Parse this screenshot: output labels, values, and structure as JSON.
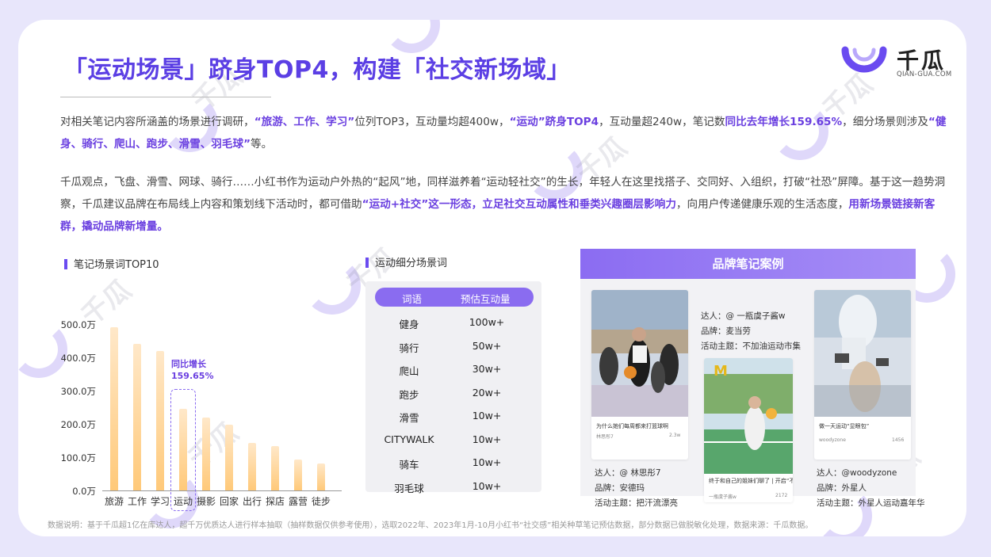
{
  "title": "「运动场景」跻身TOP4，构建「社交新场域」",
  "logo": {
    "cn": "千瓜",
    "en": "QIAN-GUA.COM"
  },
  "para1": {
    "t1": "对相关笔记内容所涵盖的场景进行调研，",
    "h1": "“旅游、工作、学习”",
    "t2": "位列TOP3，互动量均超400w，",
    "h2": "“运动”跻身TOP4",
    "t3": "，互动量超240w，笔记数",
    "h3": "同比去年增长159.65%",
    "t4": "，细分场景则涉及",
    "h4": "“健身、骑行、爬山、跑步、滑雪、羽毛球”",
    "t5": "等。"
  },
  "para2": {
    "t1": "千瓜观点，飞盘、滑雪、网球、骑行……小红书作为运动户外热的“起风”地，同样滋养着“运动轻社交”的生长，年轻人在这里找搭子、交同好、入组织，打破“社恐”屏障。基于这一趋势洞察，千瓜建议品牌在布局线上内容和策划线下活动时，都可借助",
    "h1": "“运动+社交”这一形态，立足社交互动属性和垂类兴趣圈层影响力",
    "t2": "，向用户传递健康乐观的生活态度，",
    "h2": "用新场景链接新客群，撬动品牌新增量。"
  },
  "chart_section_title": "笔记场景词TOP10",
  "chart_data": {
    "type": "bar",
    "categories": [
      "旅游",
      "工作",
      "学习",
      "运动",
      "摄影",
      "回家",
      "出行",
      "探店",
      "露营",
      "徒步"
    ],
    "values": [
      490,
      440,
      420,
      245,
      218,
      198,
      142,
      133,
      92,
      80
    ],
    "unit": "万",
    "ylim": [
      0,
      500
    ],
    "yticks": [
      "0.0万",
      "100.0万",
      "200.0万",
      "300.0万",
      "400.0万",
      "500.0万"
    ],
    "annotation": {
      "line1": "同比增长",
      "line2": "159.65%",
      "category": "运动"
    },
    "color": "#ffc979"
  },
  "table_section_title": "运动细分场景词",
  "table": {
    "headers": [
      "词语",
      "预估互动量"
    ],
    "rows": [
      [
        "健身",
        "100w+"
      ],
      [
        "骑行",
        "50w+"
      ],
      [
        "爬山",
        "30w+"
      ],
      [
        "跑步",
        "20w+"
      ],
      [
        "滑雪",
        "10w+"
      ],
      [
        "CITYWALK",
        "10w+"
      ],
      [
        "骑车",
        "10w+"
      ],
      [
        "羽毛球",
        "10w+"
      ]
    ]
  },
  "cases": {
    "title": "品牌笔记案例",
    "items": [
      {
        "caption": "为什么她们每周都来打篮球啊",
        "user": "林思彤7",
        "likes": "2.3w",
        "talent": "达人：@ 林思彤7",
        "brand": "品牌：安德玛",
        "topic": "活动主题：把汗流漂亮"
      },
      {
        "caption": "终于和自己的姐妹们聊了 | 开启“不加班”人生",
        "user": "一瓶虞子酱w",
        "likes": "2172",
        "talent": "达人：@ 一瓶虞子酱w",
        "brand": "品牌：麦当劳",
        "topic": "活动主题：不加油运动市集"
      },
      {
        "caption": "做一天运动“显眼包”",
        "user": "woodyzone",
        "likes": "1456",
        "talent": "达人：@woodyzone",
        "brand": "品牌：外星人",
        "topic": "活动主题：外星人运动嘉年华"
      }
    ]
  },
  "footnote": "数据说明：基于千瓜超1亿在库达人，超千万优质达人进行样本抽取（抽样数据仅供参考使用），选取2022年、2023年1月-10月小红书“社交感”相关种草笔记预估数据，部分数据已做脱敏化处理，数据来源：千瓜数据。",
  "watermark": {
    "cn": "千瓜",
    "en": "QIAN-GUA.COM"
  },
  "colors": {
    "accent": "#6a3fe0",
    "bar": "#ffc979",
    "header": "#8a6cf0",
    "background": "#e8e6fb"
  }
}
